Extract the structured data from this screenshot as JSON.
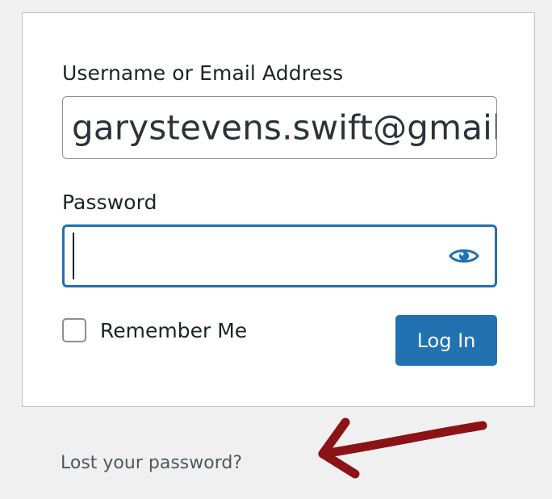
{
  "form": {
    "username_label": "Username or Email Address",
    "username_value": "garystevens.swift@gmail",
    "password_label": "Password",
    "password_value": "",
    "remember_label": "Remember Me",
    "remember_checked": false,
    "login_button_label": "Log In"
  },
  "links": {
    "lost_password": "Lost your password?"
  },
  "icons": {
    "password_toggle": "eye-icon",
    "annotation": "arrow-icon"
  },
  "colors": {
    "accent": "#2271b1",
    "annotation": "#8b1216",
    "background": "#f0f0f1"
  }
}
